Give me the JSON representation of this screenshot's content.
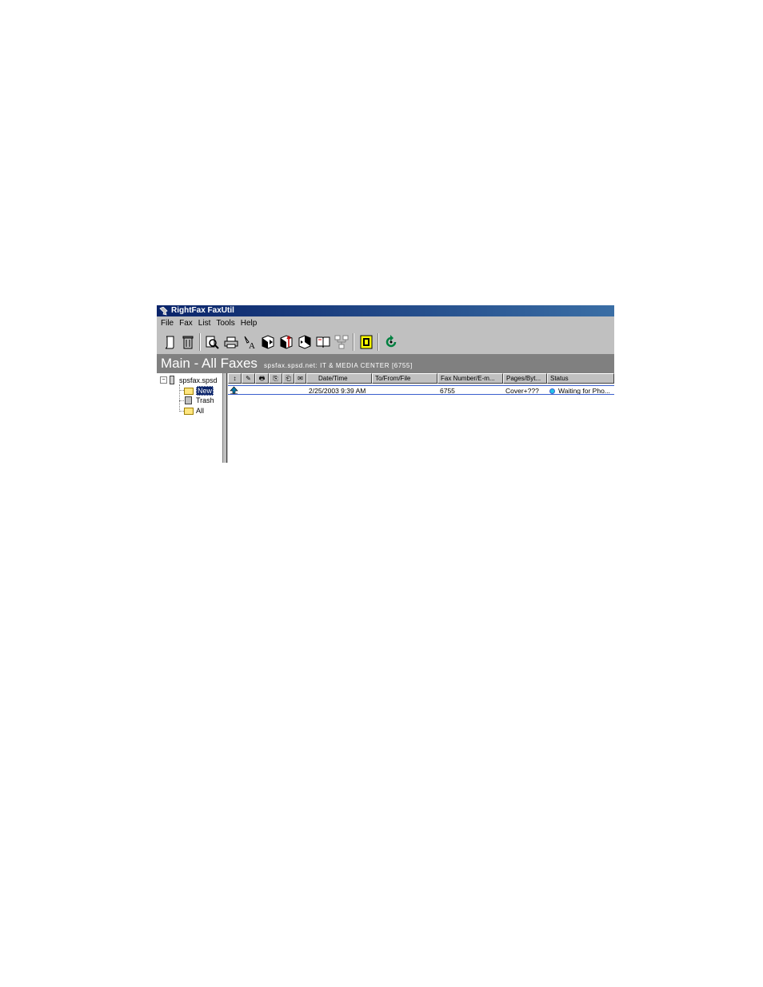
{
  "window": {
    "title": "RightFax FaxUtil"
  },
  "menu": [
    "File",
    "Fax",
    "List",
    "Tools",
    "Help"
  ],
  "toolbar": {
    "icons": [
      "new-fax-icon",
      "delete-icon",
      "view-icon",
      "print-icon",
      "annotate-icon",
      "forward-icon",
      "route-icon",
      "send-icon",
      "phonebook-icon",
      "network-icon",
      "library-icon",
      "refresh-icon"
    ]
  },
  "banner": {
    "title": "Main - All Faxes",
    "subtitle": "spsfax.spsd.net: IT & MEDIA CENTER  [6755]"
  },
  "tree": {
    "root": "spsfax.spsd",
    "items": [
      "New",
      "Trash",
      "All"
    ],
    "selected": "New"
  },
  "list": {
    "icon_columns": [
      "↕",
      "✎",
      "🖶",
      "⎘",
      "⎗",
      "✉"
    ],
    "columns": [
      "Date/Time",
      "To/From/File",
      "Fax Number/E-m...",
      "Pages/Byt...",
      "Status"
    ],
    "rows": [
      {
        "direction_icon": "upload-arrow-icon",
        "date": "2/25/2003 9:39 AM",
        "to_from": "",
        "fax_number": "6755",
        "pages": "Cover+???",
        "status": "Waiting for Pho..."
      }
    ]
  },
  "colors": {
    "titlebar": "#0a246a",
    "banner": "#808080",
    "status_dot": "#22c4e8",
    "selection": "#0a246a"
  }
}
